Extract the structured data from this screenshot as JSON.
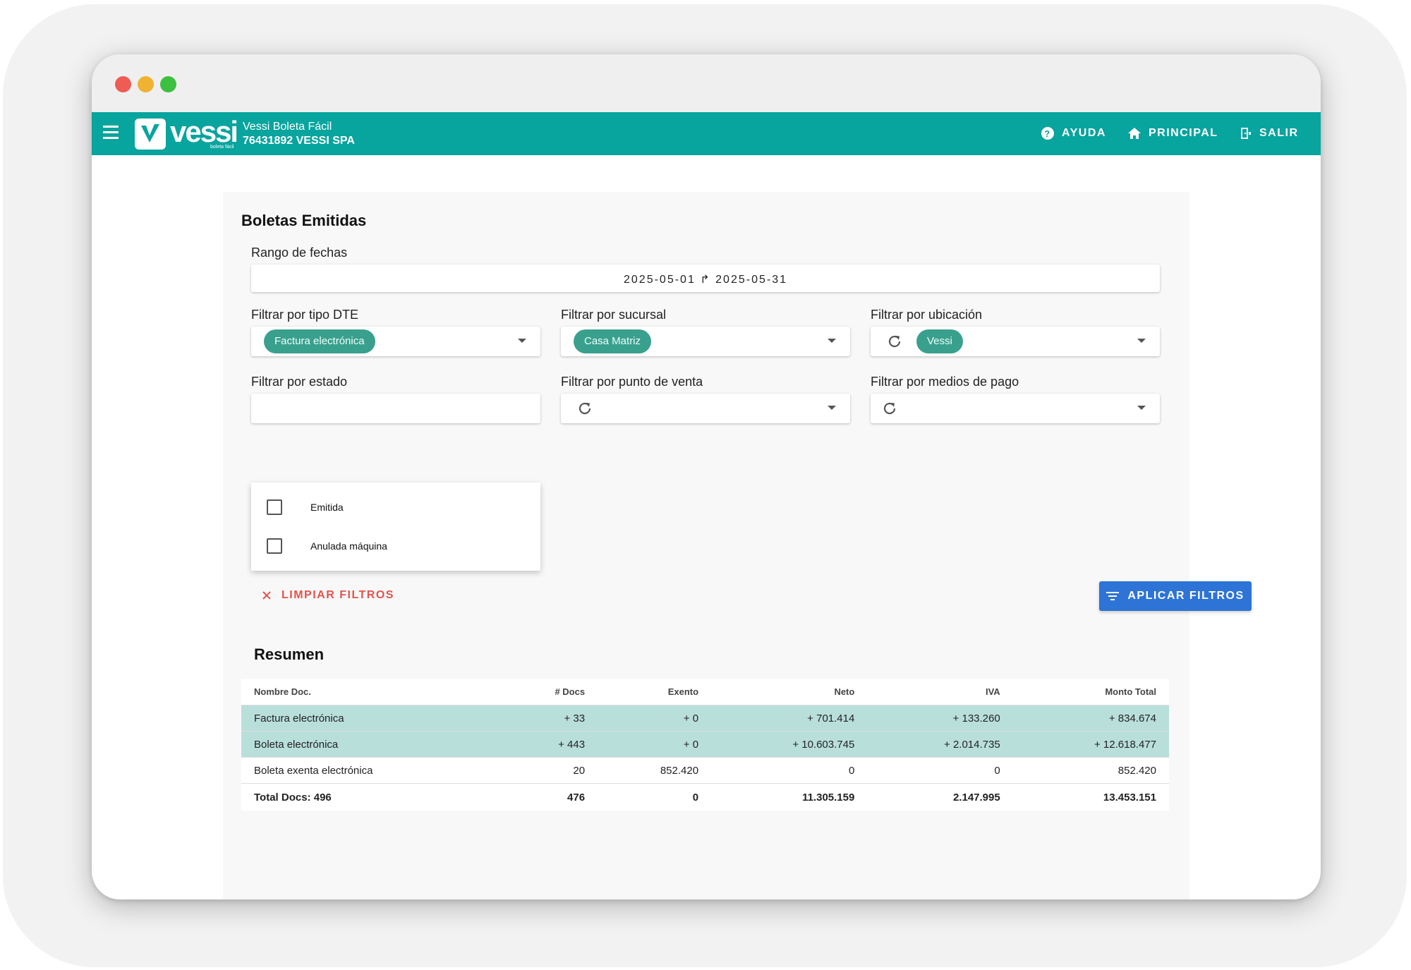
{
  "appbar": {
    "app_name": "Vessi Boleta Fácil",
    "company": "76431892 VESSI SPA",
    "logo_text": "vessi",
    "logo_subtext": "boleta fácil",
    "nav": {
      "help": "AYUDA",
      "home": "PRINCIPAL",
      "logout": "SALIR"
    }
  },
  "page": {
    "title": "Boletas Emitidas"
  },
  "filters": {
    "date_range": {
      "label": "Rango de fechas",
      "value": "2025-05-01  ↱  2025-05-31"
    },
    "dte_type": {
      "label": "Filtrar por tipo DTE",
      "chip": "Factura electrónica"
    },
    "branch": {
      "label": "Filtrar por sucursal",
      "chip": "Casa Matriz"
    },
    "location": {
      "label": "Filtrar por ubicación",
      "chip": "Vessi"
    },
    "status": {
      "label": "Filtrar por estado",
      "options": [
        "Emitida",
        "Anulada máquina"
      ]
    },
    "pos": {
      "label": "Filtrar por punto de venta"
    },
    "payment": {
      "label": "Filtrar por medios de pago"
    },
    "clear_label": "LIMPIAR FILTROS",
    "apply_label": "APLICAR FILTROS"
  },
  "summary": {
    "title": "Resumen",
    "headers": [
      "Nombre Doc.",
      "# Docs",
      "Exento",
      "Neto",
      "IVA",
      "Monto Total"
    ],
    "rows": [
      [
        "Factura electrónica",
        "+ 33",
        "+ 0",
        "+ 701.414",
        "+ 133.260",
        "+ 834.674"
      ],
      [
        "Boleta electrónica",
        "+ 443",
        "+ 0",
        "+ 10.603.745",
        "+ 2.014.735",
        "+ 12.618.477"
      ],
      [
        "Boleta exenta electrónica",
        "20",
        "852.420",
        "0",
        "0",
        "852.420"
      ]
    ],
    "total": [
      "Total Docs: 496",
      "476",
      "0",
      "11.305.159",
      "2.147.995",
      "13.453.151"
    ]
  },
  "colors": {
    "appbar": "#08a49e",
    "chip": "#3aa08e",
    "highlight_row": "#b9dfdb",
    "apply_button": "#2d74d6",
    "clear_text": "#e3534d"
  },
  "icons": {
    "menu": "hamburger-icon",
    "help": "help-circle-icon",
    "home": "home-icon",
    "logout": "exit-door-icon",
    "refresh": "refresh-icon",
    "dropdown": "caret-down-icon",
    "clear": "close-icon",
    "filter": "filter-icon"
  }
}
